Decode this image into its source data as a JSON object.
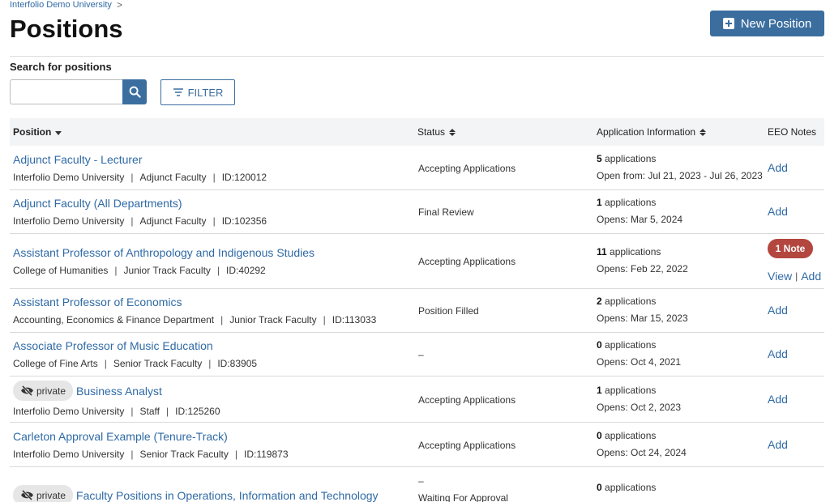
{
  "breadcrumb": {
    "label": "Interfolio Demo University",
    "separator": ">"
  },
  "page_title": "Positions",
  "new_position_label": "New Position",
  "search": {
    "label": "Search for positions",
    "value": "",
    "placeholder": ""
  },
  "filter_label": "FILTER",
  "columns": {
    "position": "Position",
    "status": "Status",
    "application_information": "Application Information",
    "eeo_notes": "EEO Notes"
  },
  "rows": [
    {
      "title": "Adjunct Faculty - Lecturer",
      "unit": "Interfolio Demo University",
      "type": "Adjunct Faculty",
      "id": "ID:120012",
      "status": "Accepting Applications",
      "app_count": "5",
      "app_suffix": " applications",
      "dates": "Open from: Jul 21, 2023 - Jul 26, 2023",
      "eeo": "Add"
    },
    {
      "title": "Adjunct Faculty (All Departments)",
      "unit": "Interfolio Demo University",
      "type": "Adjunct Faculty",
      "id": "ID:102356",
      "status": "Final Review",
      "app_count": "1",
      "app_suffix": " applications",
      "dates": "Opens: Mar 5, 2024",
      "eeo": "Add"
    },
    {
      "title": "Assistant Professor of Anthropology and Indigenous Studies",
      "unit": "College of Humanities",
      "type": "Junior Track Faculty",
      "id": "ID:40292",
      "status": "Accepting Applications",
      "app_count": "11",
      "app_suffix": " applications",
      "dates": "Opens: Feb 22, 2022",
      "note_badge": "1 Note",
      "eeo_view": "View",
      "eeo_sep": "|",
      "eeo": "Add"
    },
    {
      "title": "Assistant Professor of Economics",
      "unit": "Accounting, Economics & Finance Department",
      "type": "Junior Track Faculty",
      "id": "ID:113033",
      "status": "Position Filled",
      "app_count": "2",
      "app_suffix": " applications",
      "dates": "Opens: Mar 15, 2023",
      "eeo": "Add"
    },
    {
      "title": "Associate Professor of Music Education",
      "unit": "College of Fine Arts",
      "type": "Senior Track Faculty",
      "id": "ID:83905",
      "status": "–",
      "app_count": "0",
      "app_suffix": " applications",
      "dates": "Opens: Oct 4, 2021",
      "eeo": "Add"
    },
    {
      "private_label": "private",
      "title": "Business Analyst",
      "unit": "Interfolio Demo University",
      "type": "Staff",
      "id": "ID:125260",
      "status": "Accepting Applications",
      "app_count": "1",
      "app_suffix": " applications",
      "dates": "Opens: Oct 2, 2023",
      "eeo": "Add"
    },
    {
      "title": "Carleton Approval Example (Tenure-Track)",
      "unit": "Interfolio Demo University",
      "type": "Senior Track Faculty",
      "id": "ID:119873",
      "status": "Accepting Applications",
      "app_count": "0",
      "app_suffix": " applications",
      "dates": "Opens: Oct 24, 2024",
      "eeo": "Add"
    },
    {
      "private_label": "private",
      "title": "Faculty Positions in Operations, Information and Technology",
      "status_dash": "–",
      "status": "Waiting For Approval",
      "app_count": "0",
      "app_suffix": " applications"
    }
  ],
  "colors": {
    "primary": "#3b6e9f",
    "link": "#2f6aa5",
    "note_badge": "#b3463f",
    "header_bg": "#f2f4f6"
  }
}
